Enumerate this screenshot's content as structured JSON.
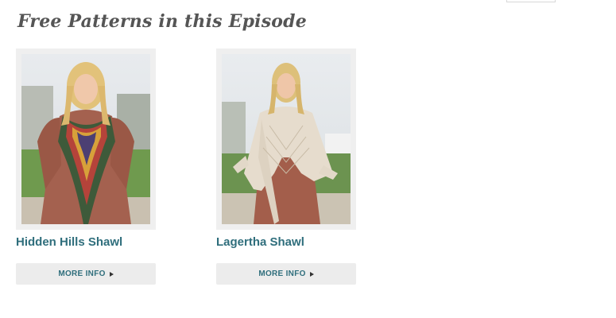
{
  "section": {
    "title": "Free Patterns in this Episode"
  },
  "patterns": [
    {
      "name": "Hidden Hills Shawl",
      "button_label": "MORE INFO"
    },
    {
      "name": "Lagertha Shawl",
      "button_label": "MORE INFO"
    }
  ],
  "icons": {
    "button_arrow": "triangle-right-icon"
  },
  "colors": {
    "title": "#555555",
    "link": "#2f6e7c",
    "button_bg": "#ececec",
    "frame_bg": "#efefef"
  }
}
